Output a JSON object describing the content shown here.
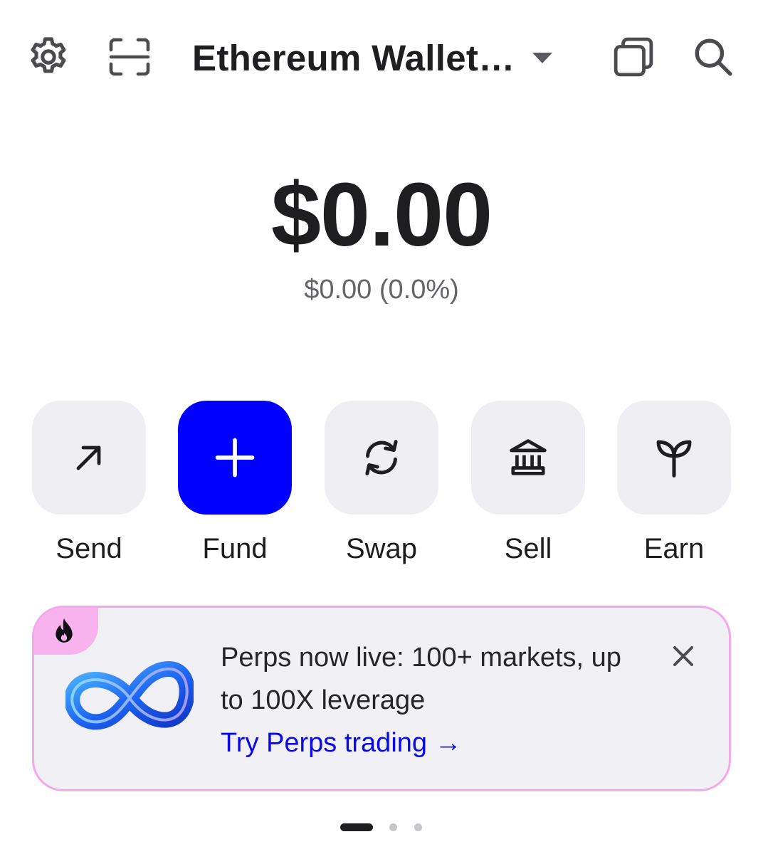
{
  "header": {
    "wallet_title": "Ethereum Wallet…",
    "icons": [
      "gear-icon",
      "scan-icon",
      "copy-icon",
      "search-icon"
    ]
  },
  "balance": {
    "amount": "$0.00",
    "change": "$0.00 (0.0%)"
  },
  "actions": [
    {
      "label": "Send",
      "icon": "arrow-up-right-icon"
    },
    {
      "label": "Fund",
      "icon": "plus-icon"
    },
    {
      "label": "Swap",
      "icon": "swap-icon"
    },
    {
      "label": "Sell",
      "icon": "bank-icon"
    },
    {
      "label": "Earn",
      "icon": "sprout-icon"
    }
  ],
  "promo": {
    "text": "Perps now live: 100+ markets, up to 100X leverage",
    "link": "Try Perps trading →",
    "icons": [
      "flame-icon",
      "infinity-icon",
      "close-icon"
    ]
  },
  "pager": {
    "pages": 3,
    "active": 1
  },
  "colors": {
    "primary": "#0000ff",
    "link": "#0a0ae8",
    "tile": "#efeff3",
    "promo_border": "#f1a9ea",
    "promo_tab": "#f8b3ef"
  }
}
